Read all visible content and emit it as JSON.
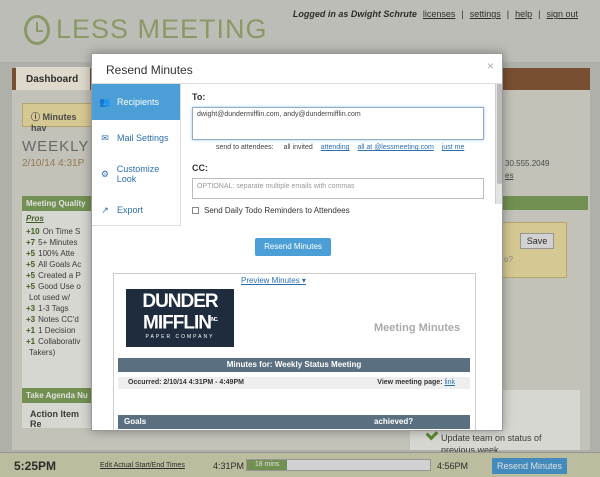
{
  "app": {
    "logo_text": "LESS MEETING"
  },
  "user_links": {
    "logged_in": "Logged in as Dwight Schrute",
    "links": [
      "licenses",
      "settings",
      "help",
      "sign out"
    ]
  },
  "tabs": {
    "dashboard": "Dashboard"
  },
  "background": {
    "alert": "Minutes hav",
    "meeting_title": "WEEKLY S",
    "meeting_date": "2/10/14 4:31P",
    "phone": "30.555.2049",
    "es": "es",
    "quality_header": "Meeting Quality",
    "pros": "Pros",
    "quality_items": [
      {
        "score": "+10",
        "text": "On Time S"
      },
      {
        "score": "+7",
        "text": "5+ Minutes"
      },
      {
        "score": "+5",
        "text": "100% Atte"
      },
      {
        "score": "+5",
        "text": "All Goals Ac"
      },
      {
        "score": "+5",
        "text": "Created a P"
      },
      {
        "score": "+5",
        "text": "Good Use o"
      },
      {
        "score": "",
        "text": "Lot used w/"
      },
      {
        "score": "+3",
        "text": "1-3 Tags"
      },
      {
        "score": "+3",
        "text": "Notes CC'd"
      },
      {
        "score": "+1",
        "text": "1 Decision"
      },
      {
        "score": "+1",
        "text": "Collaborativ"
      },
      {
        "score": "",
        "text": "Takers)"
      }
    ],
    "agenda_header": "Take Agenda Nu",
    "action_item": "Action Item Re",
    "save_label": "Save",
    "save_placeholder": "o?",
    "task_text": "Update team on status of previous week"
  },
  "bottom": {
    "clock": "5:25PM",
    "edit_link": "Edit Actual Start/End Times",
    "start": "4:31PM",
    "progress_label": "18 mins",
    "progress_fraction": 0.22,
    "end": "4:56PM",
    "resend": "Resend Minutes"
  },
  "modal": {
    "title": "Resend Minutes",
    "close": "×",
    "nav": [
      {
        "label": "Recipients",
        "icon": "users-icon",
        "glyph": "👥",
        "active": true
      },
      {
        "label": "Mail Settings",
        "icon": "mail-icon",
        "glyph": "✉",
        "active": false
      },
      {
        "label": "Customize Look",
        "icon": "cogs-icon",
        "glyph": "⚙",
        "active": false
      },
      {
        "label": "Export",
        "icon": "export-icon",
        "glyph": "↗",
        "active": false
      }
    ],
    "to_label": "To:",
    "to_value": "dwight@dundermifflin.com, andy@dundermifflin.com",
    "send_to": "send to attendees:",
    "send_options": [
      "all invited",
      "attending",
      "all at @lessmeeting.com",
      "just me"
    ],
    "cc_label": "CC:",
    "cc_placeholder": "OPTIONAL: separate multiple emails with commas",
    "daily_todo": "Send Daily Todo Reminders to Attendees",
    "resend_button": "Resend Minutes",
    "preview_link": "Preview Minutes ▾",
    "preview": {
      "logo_line1": "DUNDER",
      "logo_line2": "MIFFLIN",
      "logo_line3": "PAPER COMPANY",
      "logo_inc": "INC.",
      "minutes_title": "Meeting Minutes",
      "minutes_for": "Minutes for: Weekly Status Meeting",
      "occurred": "Occurred: 2/10/14 4:31PM - 4:49PM",
      "view_page": "View meeting page:",
      "view_link": "link",
      "goals": "Goals",
      "achieved": "achieved?"
    }
  }
}
